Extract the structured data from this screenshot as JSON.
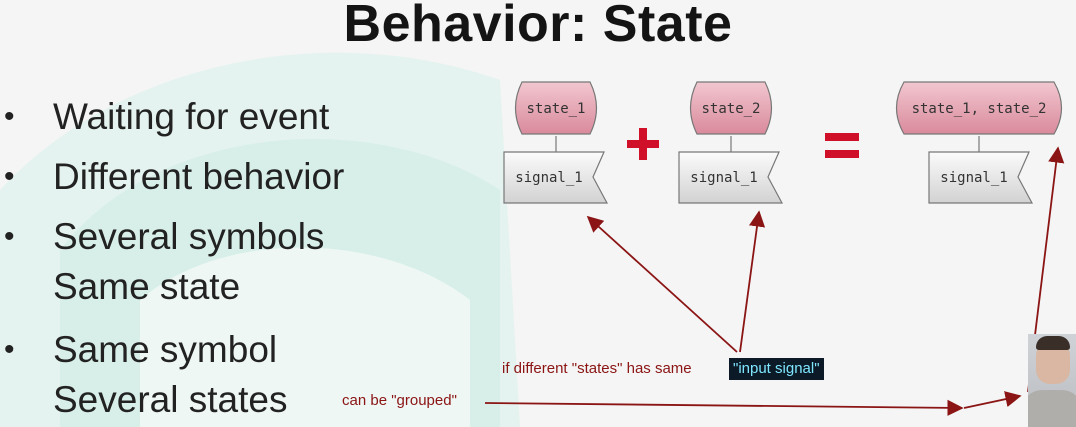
{
  "slide": {
    "title": "Behavior: State",
    "bullets": [
      {
        "line1": "Waiting for event",
        "line2": ""
      },
      {
        "line1": "Different behavior",
        "line2": ""
      },
      {
        "line1": "Several symbols",
        "line2": "Same state"
      },
      {
        "line1": "Same symbol",
        "line2": "Several states"
      }
    ],
    "bullet_glyph": "•"
  },
  "diagram": {
    "states": [
      "state_1",
      "state_2",
      "state_1, state_2"
    ],
    "signals": [
      "signal_1",
      "signal_1",
      "signal_1"
    ],
    "plus_symbol": "+",
    "equals_symbol": "=",
    "colors": {
      "state_fill": "#e6a6b3",
      "signal_fill": "#e9e9e9",
      "operator": "#d01028",
      "annotation": "#8b1414"
    }
  },
  "annotations": {
    "line1_prefix": "if different \"states\" has same ",
    "line1_highlight": "\"input signal\"",
    "line2": "can be \"grouped\""
  }
}
